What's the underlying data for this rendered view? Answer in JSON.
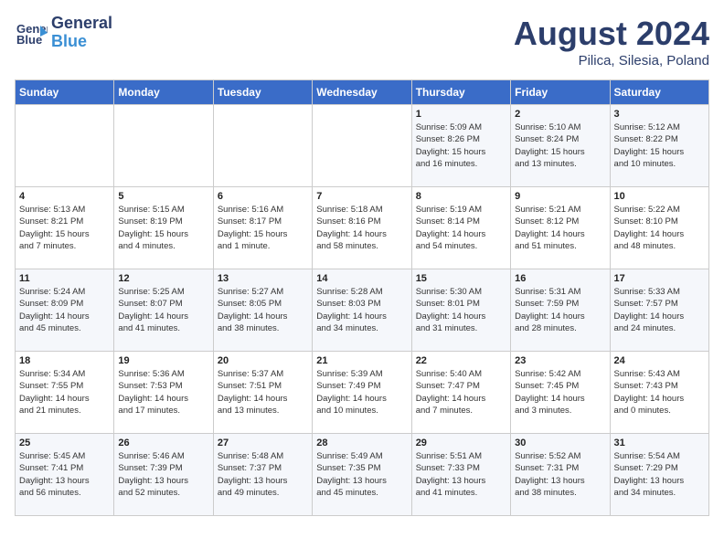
{
  "header": {
    "logo_line1": "General",
    "logo_line2": "Blue",
    "month": "August 2024",
    "location": "Pilica, Silesia, Poland"
  },
  "weekdays": [
    "Sunday",
    "Monday",
    "Tuesday",
    "Wednesday",
    "Thursday",
    "Friday",
    "Saturday"
  ],
  "weeks": [
    [
      {
        "day": "",
        "info": ""
      },
      {
        "day": "",
        "info": ""
      },
      {
        "day": "",
        "info": ""
      },
      {
        "day": "",
        "info": ""
      },
      {
        "day": "1",
        "info": "Sunrise: 5:09 AM\nSunset: 8:26 PM\nDaylight: 15 hours\nand 16 minutes."
      },
      {
        "day": "2",
        "info": "Sunrise: 5:10 AM\nSunset: 8:24 PM\nDaylight: 15 hours\nand 13 minutes."
      },
      {
        "day": "3",
        "info": "Sunrise: 5:12 AM\nSunset: 8:22 PM\nDaylight: 15 hours\nand 10 minutes."
      }
    ],
    [
      {
        "day": "4",
        "info": "Sunrise: 5:13 AM\nSunset: 8:21 PM\nDaylight: 15 hours\nand 7 minutes."
      },
      {
        "day": "5",
        "info": "Sunrise: 5:15 AM\nSunset: 8:19 PM\nDaylight: 15 hours\nand 4 minutes."
      },
      {
        "day": "6",
        "info": "Sunrise: 5:16 AM\nSunset: 8:17 PM\nDaylight: 15 hours\nand 1 minute."
      },
      {
        "day": "7",
        "info": "Sunrise: 5:18 AM\nSunset: 8:16 PM\nDaylight: 14 hours\nand 58 minutes."
      },
      {
        "day": "8",
        "info": "Sunrise: 5:19 AM\nSunset: 8:14 PM\nDaylight: 14 hours\nand 54 minutes."
      },
      {
        "day": "9",
        "info": "Sunrise: 5:21 AM\nSunset: 8:12 PM\nDaylight: 14 hours\nand 51 minutes."
      },
      {
        "day": "10",
        "info": "Sunrise: 5:22 AM\nSunset: 8:10 PM\nDaylight: 14 hours\nand 48 minutes."
      }
    ],
    [
      {
        "day": "11",
        "info": "Sunrise: 5:24 AM\nSunset: 8:09 PM\nDaylight: 14 hours\nand 45 minutes."
      },
      {
        "day": "12",
        "info": "Sunrise: 5:25 AM\nSunset: 8:07 PM\nDaylight: 14 hours\nand 41 minutes."
      },
      {
        "day": "13",
        "info": "Sunrise: 5:27 AM\nSunset: 8:05 PM\nDaylight: 14 hours\nand 38 minutes."
      },
      {
        "day": "14",
        "info": "Sunrise: 5:28 AM\nSunset: 8:03 PM\nDaylight: 14 hours\nand 34 minutes."
      },
      {
        "day": "15",
        "info": "Sunrise: 5:30 AM\nSunset: 8:01 PM\nDaylight: 14 hours\nand 31 minutes."
      },
      {
        "day": "16",
        "info": "Sunrise: 5:31 AM\nSunset: 7:59 PM\nDaylight: 14 hours\nand 28 minutes."
      },
      {
        "day": "17",
        "info": "Sunrise: 5:33 AM\nSunset: 7:57 PM\nDaylight: 14 hours\nand 24 minutes."
      }
    ],
    [
      {
        "day": "18",
        "info": "Sunrise: 5:34 AM\nSunset: 7:55 PM\nDaylight: 14 hours\nand 21 minutes."
      },
      {
        "day": "19",
        "info": "Sunrise: 5:36 AM\nSunset: 7:53 PM\nDaylight: 14 hours\nand 17 minutes."
      },
      {
        "day": "20",
        "info": "Sunrise: 5:37 AM\nSunset: 7:51 PM\nDaylight: 14 hours\nand 13 minutes."
      },
      {
        "day": "21",
        "info": "Sunrise: 5:39 AM\nSunset: 7:49 PM\nDaylight: 14 hours\nand 10 minutes."
      },
      {
        "day": "22",
        "info": "Sunrise: 5:40 AM\nSunset: 7:47 PM\nDaylight: 14 hours\nand 7 minutes."
      },
      {
        "day": "23",
        "info": "Sunrise: 5:42 AM\nSunset: 7:45 PM\nDaylight: 14 hours\nand 3 minutes."
      },
      {
        "day": "24",
        "info": "Sunrise: 5:43 AM\nSunset: 7:43 PM\nDaylight: 14 hours\nand 0 minutes."
      }
    ],
    [
      {
        "day": "25",
        "info": "Sunrise: 5:45 AM\nSunset: 7:41 PM\nDaylight: 13 hours\nand 56 minutes."
      },
      {
        "day": "26",
        "info": "Sunrise: 5:46 AM\nSunset: 7:39 PM\nDaylight: 13 hours\nand 52 minutes."
      },
      {
        "day": "27",
        "info": "Sunrise: 5:48 AM\nSunset: 7:37 PM\nDaylight: 13 hours\nand 49 minutes."
      },
      {
        "day": "28",
        "info": "Sunrise: 5:49 AM\nSunset: 7:35 PM\nDaylight: 13 hours\nand 45 minutes."
      },
      {
        "day": "29",
        "info": "Sunrise: 5:51 AM\nSunset: 7:33 PM\nDaylight: 13 hours\nand 41 minutes."
      },
      {
        "day": "30",
        "info": "Sunrise: 5:52 AM\nSunset: 7:31 PM\nDaylight: 13 hours\nand 38 minutes."
      },
      {
        "day": "31",
        "info": "Sunrise: 5:54 AM\nSunset: 7:29 PM\nDaylight: 13 hours\nand 34 minutes."
      }
    ]
  ]
}
